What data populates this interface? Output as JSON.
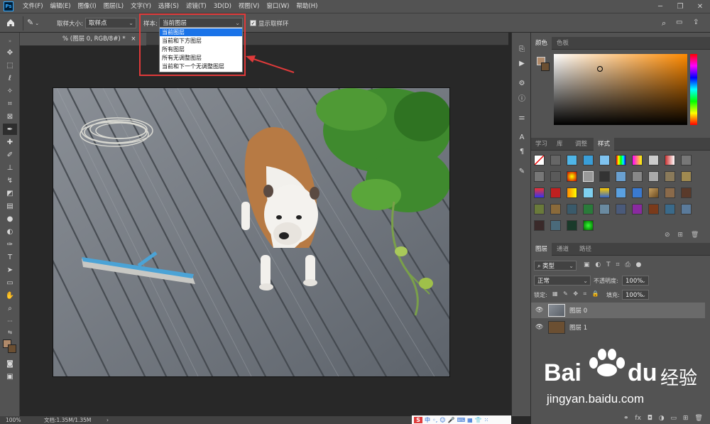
{
  "menubar": {
    "logo": "Ps",
    "items": [
      "文件(F)",
      "编辑(E)",
      "图像(I)",
      "图层(L)",
      "文字(Y)",
      "选择(S)",
      "滤镜(T)",
      "3D(D)",
      "视图(V)",
      "窗口(W)",
      "帮助(H)"
    ]
  },
  "options": {
    "sample_size_label": "取样大小:",
    "sample_size_value": "取样点",
    "sample_label": "样本:",
    "sample_value": "当前图层",
    "show_ring_label": "显示取样环"
  },
  "sample_dropdown": {
    "options": [
      "当前图层",
      "当前和下方图层",
      "所有图层",
      "所有无调整图层",
      "当前和下一个无调整图层"
    ],
    "selected_index": 0
  },
  "document": {
    "tab_title": "% (图层 0, RGB/8#) *",
    "close": "×"
  },
  "status": {
    "zoom": "100%",
    "doc_info": "文档:1.35M/1.35M"
  },
  "color_panel": {
    "tabs": [
      "颜色",
      "色板"
    ],
    "foreground": "#b08a6a",
    "background": "#6b4f32",
    "hue_color": "#ff8a00"
  },
  "styles_panel": {
    "tabs": [
      "学习",
      "库",
      "调整",
      "样式"
    ]
  },
  "layers_panel": {
    "tabs": [
      "图层",
      "通道",
      "路径"
    ],
    "filter_label": "类型",
    "blend_mode": "正常",
    "opacity_label": "不透明度:",
    "opacity_value": "100%",
    "lock_label": "锁定:",
    "fill_label": "填充:",
    "fill_value": "100%",
    "layers": [
      {
        "name": "图层 0",
        "selected": true
      },
      {
        "name": "图层 1",
        "selected": false
      }
    ]
  },
  "watermark": {
    "brand": "Bai",
    "brand2": "du",
    "product": "经验",
    "url": "jingyan.baidu.com"
  },
  "ime": {
    "label": "中"
  }
}
